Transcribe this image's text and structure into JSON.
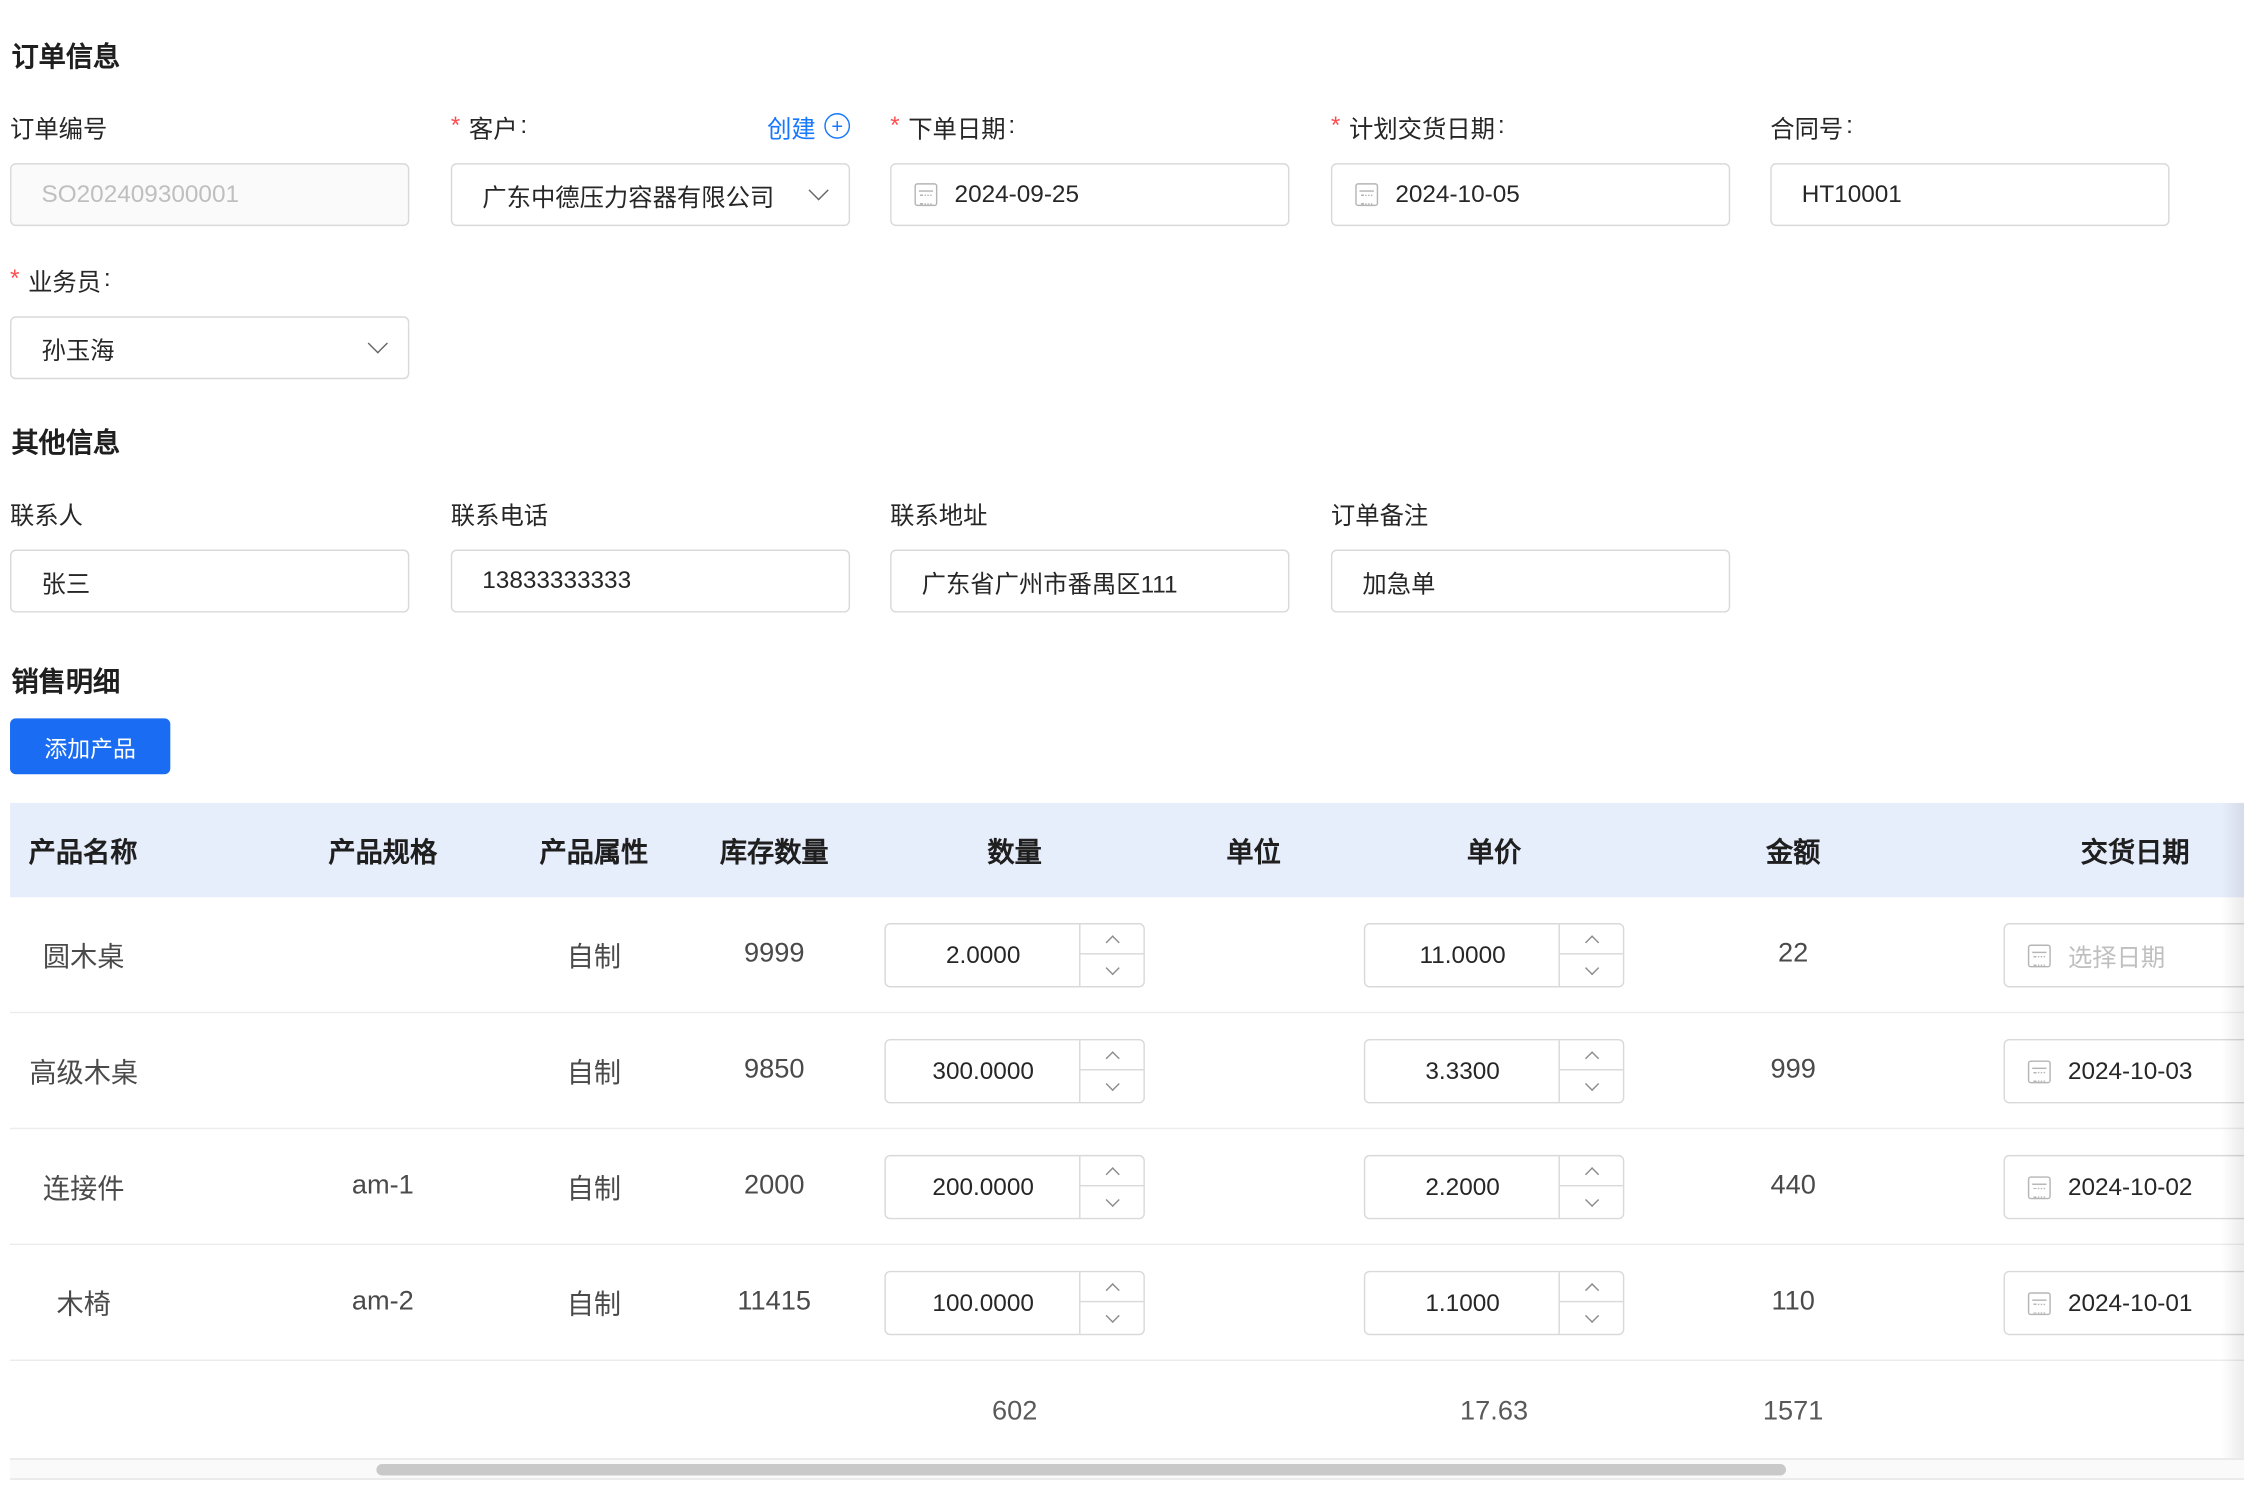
{
  "sections": {
    "order_info": "订单信息",
    "other_info": "其他信息",
    "sales_detail": "销售明细"
  },
  "order": {
    "order_no_label": "订单编号",
    "order_no_placeholder": "SO202409300001",
    "customer_label": "客户",
    "customer_create": "创建",
    "customer_value": "广东中德压力容器有限公司",
    "order_date_label": "下单日期",
    "order_date_value": "2024-09-25",
    "delivery_date_label": "计划交货日期",
    "delivery_date_value": "2024-10-05",
    "contract_label": "合同号",
    "contract_value": "HT10001",
    "salesman_label": "业务员",
    "salesman_value": "孙玉海",
    "colon": ":"
  },
  "other": {
    "contact_label": "联系人",
    "contact_value": "张三",
    "phone_label": "联系电话",
    "phone_value": "13833333333",
    "address_label": "联系地址",
    "address_value": "广东省广州市番禺区111",
    "remark_label": "订单备注",
    "remark_value": "加急单"
  },
  "add_product_button": "添加产品",
  "table": {
    "headers": [
      "产品名称",
      "产品规格",
      "产品属性",
      "库存数量",
      "数量",
      "单位",
      "单价",
      "金额",
      "交货日期"
    ],
    "rows": [
      {
        "name": "圆木桌",
        "spec": "",
        "attr": "自制",
        "stock": "9999",
        "qty": "2.0000",
        "unit": "",
        "price": "11.0000",
        "amount": "22",
        "date": "选择日期",
        "date_placeholder": true
      },
      {
        "name": "高级木桌",
        "spec": "",
        "attr": "自制",
        "stock": "9850",
        "qty": "300.0000",
        "unit": "",
        "price": "3.3300",
        "amount": "999",
        "date": "2024-10-03",
        "date_placeholder": false
      },
      {
        "name": "连接件",
        "spec": "am-1",
        "attr": "自制",
        "stock": "2000",
        "qty": "200.0000",
        "unit": "",
        "price": "2.2000",
        "amount": "440",
        "date": "2024-10-02",
        "date_placeholder": false
      },
      {
        "name": "木椅",
        "spec": "am-2",
        "attr": "自制",
        "stock": "11415",
        "qty": "100.0000",
        "unit": "",
        "price": "1.1000",
        "amount": "110",
        "date": "2024-10-01",
        "date_placeholder": false
      }
    ],
    "summary": {
      "qty": "602",
      "price": "17.63",
      "amount": "1571"
    }
  },
  "icons": {
    "calendar": "calendar-icon",
    "chevron": "chevron-down-icon",
    "plus": "plus-circle-icon"
  },
  "colors": {
    "primary": "#1a6df2",
    "link": "#1677ff",
    "required": "#ff4d4f",
    "table_header_bg": "#e7eefb"
  }
}
